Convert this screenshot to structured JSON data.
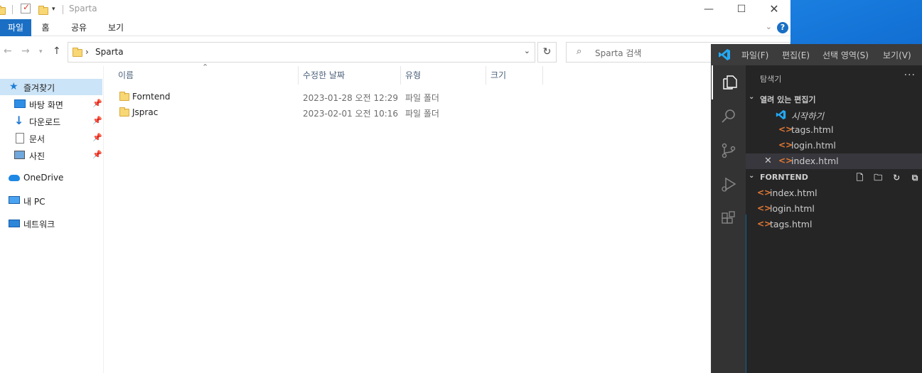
{
  "explorer": {
    "title": "Sparta",
    "ribbon_tabs": [
      "파일",
      "홈",
      "공유",
      "보기"
    ],
    "help": "?",
    "address": "Sparta",
    "search_placeholder": "Sparta 검색",
    "nav_items": [
      {
        "label": "즐겨찾기",
        "icon": "star-icon"
      },
      {
        "label": "바탕 화면",
        "icon": "desktop-icon"
      },
      {
        "label": "다운로드",
        "icon": "download-icon"
      },
      {
        "label": "문서",
        "icon": "document-icon"
      },
      {
        "label": "사진",
        "icon": "pictures-icon"
      },
      {
        "label": "OneDrive",
        "icon": "cloud-icon"
      },
      {
        "label": "내 PC",
        "icon": "pc-icon"
      },
      {
        "label": "네트워크",
        "icon": "network-icon"
      }
    ],
    "columns": [
      "이름",
      "수정한 날짜",
      "유형",
      "크기"
    ],
    "files": [
      {
        "name": "Forntend",
        "date": "2023-01-28 오전 12:29",
        "type": "파일 폴더"
      },
      {
        "name": "Jsprac",
        "date": "2023-02-01 오전 10:16",
        "type": "파일 폴더"
      }
    ]
  },
  "vscode": {
    "menus": [
      "파일(F)",
      "편집(E)",
      "선택 영역(S)",
      "보기(V)"
    ],
    "sidebar_title": "탐색기",
    "more": "···",
    "open_editors": {
      "title": "열려 있는 편집기",
      "items": [
        {
          "label": "시작하기",
          "kind": "vscode-icon"
        },
        {
          "label": "tags.html",
          "kind": "html"
        },
        {
          "label": "login.html",
          "kind": "html"
        },
        {
          "label": "index.html",
          "kind": "html",
          "selected": true
        }
      ]
    },
    "folder": {
      "title": "FORNTEND",
      "files": [
        "index.html",
        "login.html",
        "tags.html"
      ]
    },
    "html_glyph": "<>",
    "accent": "#0e639c"
  }
}
